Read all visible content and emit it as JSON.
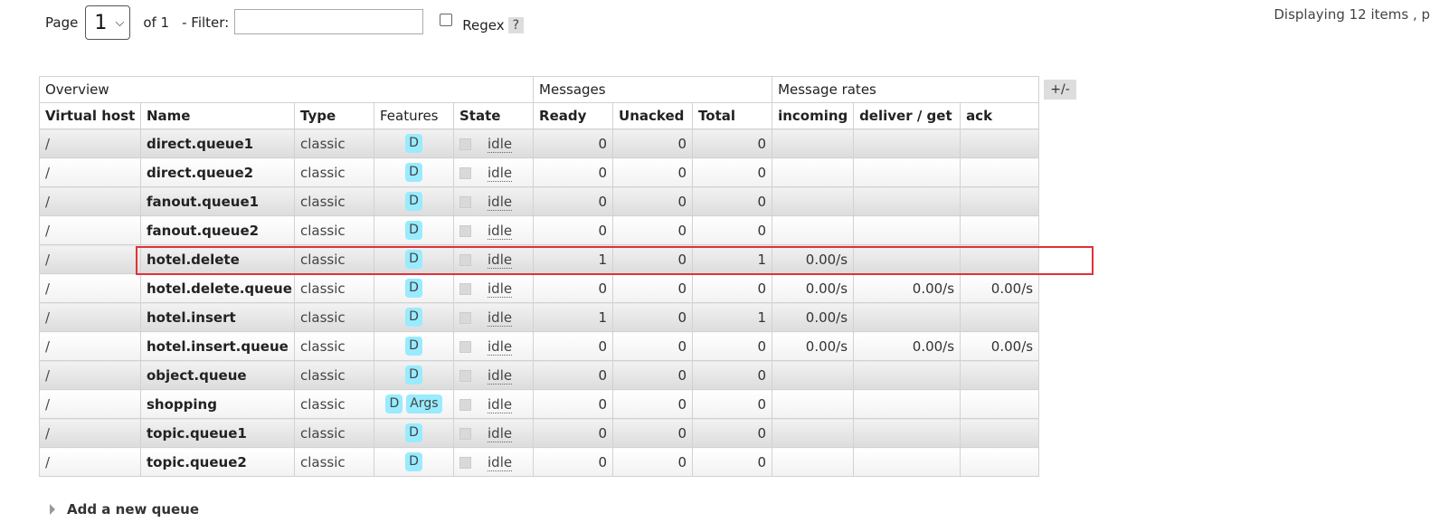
{
  "pagination": {
    "page_label": "Page",
    "page_value": "1",
    "of_label": "of 1",
    "filter_label": "- Filter:",
    "filter_value": "",
    "regex_label": "Regex",
    "regex_checked": false,
    "help_label": "?"
  },
  "displaying_text": "Displaying 12 items , p",
  "table": {
    "groups": [
      "Overview",
      "Messages",
      "Message rates"
    ],
    "columns": [
      "Virtual host",
      "Name",
      "Type",
      "Features",
      "State",
      "Ready",
      "Unacked",
      "Total",
      "incoming",
      "deliver / get",
      "ack"
    ],
    "rows": [
      {
        "vhost": "/",
        "name": "direct.queue1",
        "type": "classic",
        "features": [
          "D"
        ],
        "state": "idle",
        "ready": "0",
        "unacked": "0",
        "total": "0",
        "incoming": "",
        "deliver_get": "",
        "ack": ""
      },
      {
        "vhost": "/",
        "name": "direct.queue2",
        "type": "classic",
        "features": [
          "D"
        ],
        "state": "idle",
        "ready": "0",
        "unacked": "0",
        "total": "0",
        "incoming": "",
        "deliver_get": "",
        "ack": ""
      },
      {
        "vhost": "/",
        "name": "fanout.queue1",
        "type": "classic",
        "features": [
          "D"
        ],
        "state": "idle",
        "ready": "0",
        "unacked": "0",
        "total": "0",
        "incoming": "",
        "deliver_get": "",
        "ack": ""
      },
      {
        "vhost": "/",
        "name": "fanout.queue2",
        "type": "classic",
        "features": [
          "D"
        ],
        "state": "idle",
        "ready": "0",
        "unacked": "0",
        "total": "0",
        "incoming": "",
        "deliver_get": "",
        "ack": ""
      },
      {
        "vhost": "/",
        "name": "hotel.delete",
        "type": "classic",
        "features": [
          "D"
        ],
        "state": "idle",
        "ready": "1",
        "unacked": "0",
        "total": "1",
        "incoming": "0.00/s",
        "deliver_get": "",
        "ack": ""
      },
      {
        "vhost": "/",
        "name": "hotel.delete.queue",
        "type": "classic",
        "features": [
          "D"
        ],
        "state": "idle",
        "ready": "0",
        "unacked": "0",
        "total": "0",
        "incoming": "0.00/s",
        "deliver_get": "0.00/s",
        "ack": "0.00/s"
      },
      {
        "vhost": "/",
        "name": "hotel.insert",
        "type": "classic",
        "features": [
          "D"
        ],
        "state": "idle",
        "ready": "1",
        "unacked": "0",
        "total": "1",
        "incoming": "0.00/s",
        "deliver_get": "",
        "ack": ""
      },
      {
        "vhost": "/",
        "name": "hotel.insert.queue",
        "type": "classic",
        "features": [
          "D"
        ],
        "state": "idle",
        "ready": "0",
        "unacked": "0",
        "total": "0",
        "incoming": "0.00/s",
        "deliver_get": "0.00/s",
        "ack": "0.00/s"
      },
      {
        "vhost": "/",
        "name": "object.queue",
        "type": "classic",
        "features": [
          "D"
        ],
        "state": "idle",
        "ready": "0",
        "unacked": "0",
        "total": "0",
        "incoming": "",
        "deliver_get": "",
        "ack": ""
      },
      {
        "vhost": "/",
        "name": "shopping",
        "type": "classic",
        "features": [
          "D",
          "Args"
        ],
        "state": "idle",
        "ready": "0",
        "unacked": "0",
        "total": "0",
        "incoming": "",
        "deliver_get": "",
        "ack": ""
      },
      {
        "vhost": "/",
        "name": "topic.queue1",
        "type": "classic",
        "features": [
          "D"
        ],
        "state": "idle",
        "ready": "0",
        "unacked": "0",
        "total": "0",
        "incoming": "",
        "deliver_get": "",
        "ack": ""
      },
      {
        "vhost": "/",
        "name": "topic.queue2",
        "type": "classic",
        "features": [
          "D"
        ],
        "state": "idle",
        "ready": "0",
        "unacked": "0",
        "total": "0",
        "incoming": "",
        "deliver_get": "",
        "ack": ""
      }
    ],
    "highlighted_row_name": "hotel.delete",
    "highlight_color": "#e0323a"
  },
  "columns_toggle_label": "+/-",
  "add_queue_label": "Add a new queue",
  "colors": {
    "feature_badge_bg": "#99ebff",
    "row_odd": "#e6e6e6",
    "row_even": "#f7f7f7"
  }
}
